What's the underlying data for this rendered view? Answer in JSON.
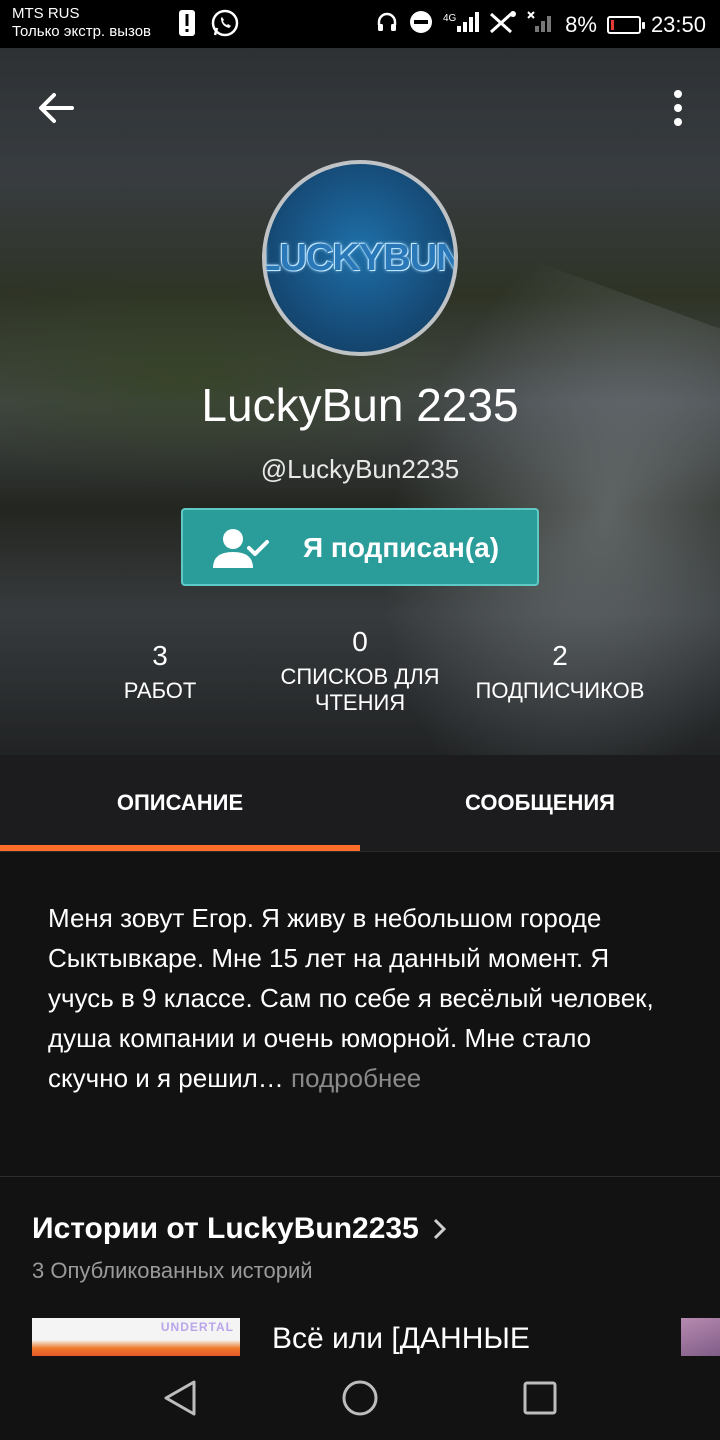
{
  "status_bar": {
    "carrier": "MTS RUS",
    "emergency": "Только экстр. вызов",
    "battery": "8%",
    "time": "23:50",
    "network": "4G"
  },
  "profile": {
    "display_name": "LuckyBun 2235",
    "username": "@LuckyBun2235",
    "avatar_text": "LUCKYBUN",
    "follow_label": "Я подписан(а)",
    "stats": {
      "works_count": "3",
      "works_label": "РАБОТ",
      "lists_count": "0",
      "lists_label_line1": "СПИСКОВ ДЛЯ",
      "lists_label_line2": "ЧТЕНИЯ",
      "followers_count": "2",
      "followers_label": "ПОДПИСЧИКОВ"
    }
  },
  "tabs": {
    "description": "ОПИСАНИЕ",
    "messages": "СООБЩЕНИЯ"
  },
  "description": {
    "text": "Меня зовут Егор. Я живу в небольшом городе Сыктывкаре. Мне 15 лет на данный момент. Я учусь в 9 классе. Сам по себе я весёлый человек, душа компании и очень юморной. Мне стало скучно и я решил…",
    "more": " подробнее"
  },
  "stories": {
    "title": "Истории от LuckyBun2235",
    "subtitle": "3 Опубликованных историй",
    "first_story_title": "Всё или [ДАННЫЕ",
    "first_story_cover_text": "UNDERTAL"
  },
  "colors": {
    "accent": "#ff6d2a",
    "follow_button": "#2a9d9a",
    "background": "#121212"
  }
}
